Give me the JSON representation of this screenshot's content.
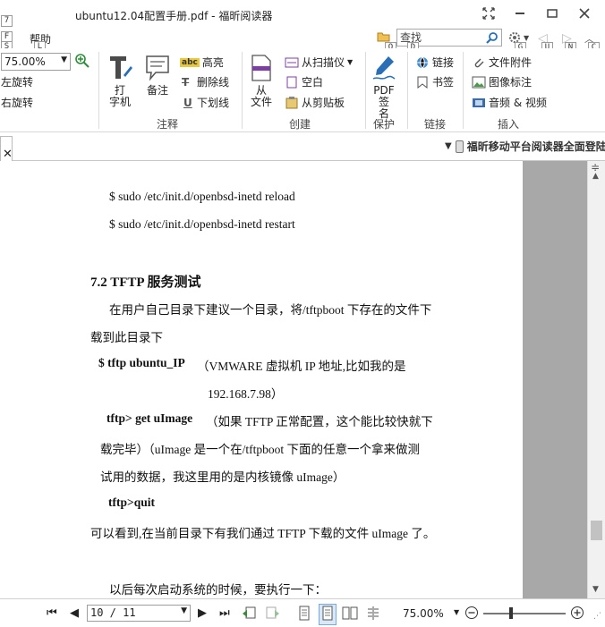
{
  "window": {
    "title": "ubuntu12.04配置手册.pdf - 福昕阅读器",
    "qa_keys": [
      "7",
      "F",
      "S",
      "L",
      "Q",
      "D",
      "G",
      "U",
      "N",
      "C"
    ]
  },
  "menu": {
    "help": "帮助"
  },
  "search": {
    "placeholder": "查找"
  },
  "ribbon": {
    "zoom_value": "75.00%",
    "rotate_left": "向左旋转",
    "rotate_right": "向右旋转",
    "annotate": {
      "typewriter": "打\n字机",
      "note": "备注",
      "highlight": "高亮",
      "strikeout": "删除线",
      "underline": "下划线",
      "group": "注释"
    },
    "create": {
      "from_file": "从\n文件",
      "from_scanner": "从扫描仪",
      "blank": "空白",
      "from_clipboard": "从剪贴板",
      "group": "创建"
    },
    "protect": {
      "pdf_sign": "PDF签\n名",
      "group": "保护"
    },
    "links": {
      "link": "链接",
      "bookmark": "书签",
      "group": "链接"
    },
    "insert": {
      "file_attachment": "文件附件",
      "image_annotation": "图像标注",
      "audio_video": "音频 & 视频",
      "group": "插入"
    }
  },
  "tabs": {
    "promo": "福昕移动平台阅读器全面登陆"
  },
  "document": {
    "lines": [
      "$ sudo /etc/init.d/openbsd-inetd reload",
      "$ sudo /etc/init.d/openbsd-inetd restart",
      "7.2 TFTP 服务测试",
      "在用户自己目录下建议一个目录，将/tftpboot 下存在的文件下",
      "载到此目录下",
      "$ tftp ubuntu_IP",
      "（VMWARE 虚拟机  IP 地址,比如我的是",
      "192.168.7.98）",
      "tftp> get uImage",
      "（如果  TFTP  正常配置，这个能比较快就下",
      "载完毕）（uImage  是一个在/tftpboot 下面的任意一个拿来做测",
      "试用的数据，我这里用的是内核镜像 uImage）",
      "tftp>quit",
      "可以看到,在当前目录下有我们通过 TFTP 下载的文件 uImage 了。",
      "以后每次启动系统的时候，要执行一下："
    ]
  },
  "statusbar": {
    "page_value": "10 / 11",
    "zoom_value": "75.00%",
    "zoom_slider_percent": 75
  }
}
